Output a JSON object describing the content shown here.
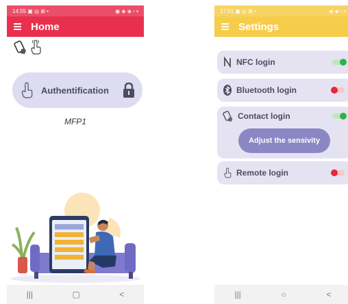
{
  "left_phone": {
    "status_left": "14:55 ▣ ◎ ⊞ •",
    "status_right": "◉ ◈ ◈ ▫ ▪",
    "appbar_title": "Home",
    "auth_label": "Authentification",
    "device_name": "MFP1",
    "nav": [
      "|||",
      "▢",
      "<"
    ],
    "colors": {
      "accent": "#e8304e",
      "pill": "#dedcf0"
    },
    "icons": [
      "phone-contact-icon",
      "hand-touch-icon",
      "lock-icon",
      "menu-icon"
    ]
  },
  "right_phone": {
    "status_left": "17:51 ▣ ◎ ⊞ •",
    "status_right": "◈ ◈ ▫ ▪",
    "appbar_title": "Settings",
    "settings": [
      {
        "label": "NFC login",
        "enabled": true,
        "icon": "nfc-icon"
      },
      {
        "label": "Bluetooth login",
        "enabled": false,
        "icon": "bluetooth-icon"
      },
      {
        "label": "Contact login",
        "enabled": true,
        "icon": "contact-icon"
      },
      {
        "label": "Remote login",
        "enabled": false,
        "icon": "remote-touch-icon"
      }
    ],
    "adjust_button": "Adjust the sensivity",
    "nav": [
      "|||",
      "○",
      "<"
    ],
    "colors": {
      "accent": "#f6cc4b",
      "toggle_on": "#2fb24a",
      "toggle_off": "#e5283a"
    }
  }
}
